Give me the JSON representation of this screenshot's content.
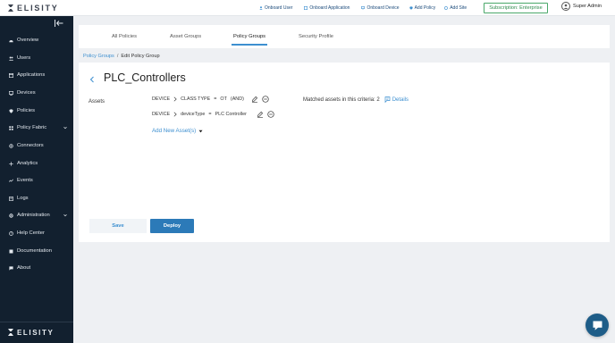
{
  "brand": {
    "name": "ELISITY"
  },
  "topnav": {
    "items": [
      {
        "label": "Onboard User",
        "icon": "user-plus-icon"
      },
      {
        "label": "Onboard Application",
        "icon": "app-plus-icon"
      },
      {
        "label": "Onboard Device",
        "icon": "device-plus-icon"
      },
      {
        "label": "Add Policy",
        "icon": "policy-plus-icon"
      },
      {
        "label": "Add Site",
        "icon": "site-plus-icon"
      }
    ],
    "subscription": "Subscription: Enterprise",
    "user": "Super Admin"
  },
  "sidebar": {
    "items": [
      {
        "label": "Overview",
        "icon": "overview-icon"
      },
      {
        "label": "Users",
        "icon": "users-icon"
      },
      {
        "label": "Applications",
        "icon": "applications-icon"
      },
      {
        "label": "Devices",
        "icon": "devices-icon"
      },
      {
        "label": "Policies",
        "icon": "shield-icon"
      },
      {
        "label": "Policy Fabric",
        "icon": "fabric-icon"
      },
      {
        "label": "Connectors",
        "icon": "connectors-icon"
      },
      {
        "label": "Analytics",
        "icon": "analytics-icon"
      },
      {
        "label": "Events",
        "icon": "events-icon"
      },
      {
        "label": "Logs",
        "icon": "logs-icon"
      },
      {
        "label": "Administration",
        "icon": "gear-icon"
      },
      {
        "label": "Help Center",
        "icon": "help-icon"
      },
      {
        "label": "Documentation",
        "icon": "doc-icon"
      },
      {
        "label": "About",
        "icon": "about-icon"
      }
    ]
  },
  "tabs": [
    {
      "label": "All Policies"
    },
    {
      "label": "Asset Groups"
    },
    {
      "label": "Policy Groups",
      "active": true
    },
    {
      "label": "Security Profile"
    }
  ],
  "breadcrumb": {
    "link": "Policy Groups",
    "separator": "/",
    "current": "Edit Policy Group"
  },
  "page": {
    "title": "PLC_Controllers",
    "assets_label": "Assets",
    "criteria": [
      {
        "scope": "DEVICE",
        "attribute": "CLASS TYPE",
        "operator": "=",
        "value": "OT",
        "join": "(AND)"
      },
      {
        "scope": "DEVICE",
        "attribute": "deviceType",
        "operator": "=",
        "value": "PLC Controller"
      }
    ],
    "add_asset": "Add New Asset(s)",
    "matched_text": "Matched assets in this criteria: 2",
    "details": "Details"
  },
  "buttons": {
    "save": "Save",
    "deploy": "Deploy"
  },
  "colors": {
    "accent": "#3d8fd0",
    "sidebar": "#12202f",
    "deploy": "#2c7ab8",
    "subscription": "#2e8a4c"
  }
}
